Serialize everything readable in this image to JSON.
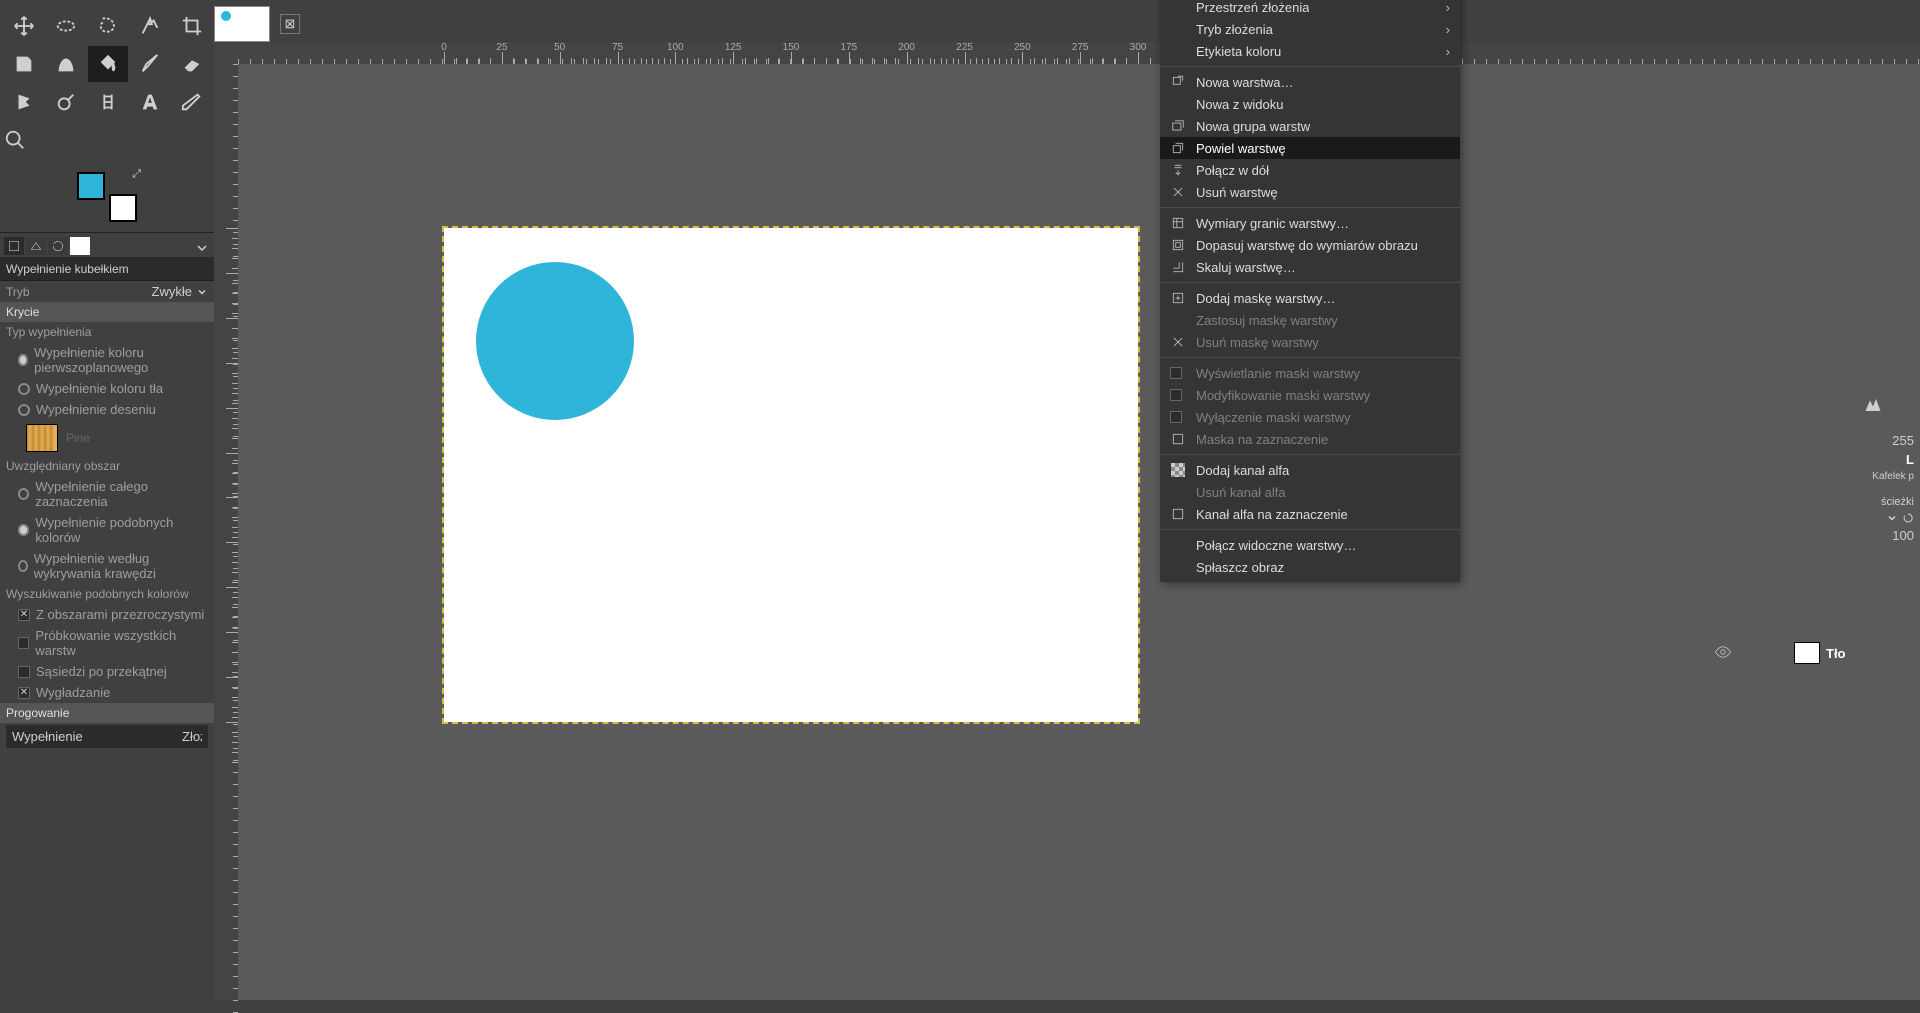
{
  "tools": {
    "names": [
      "move-tool",
      "rect-select-tool",
      "free-select-tool",
      "fuzzy-select-tool",
      "crop-tool",
      "rotate-tool",
      "flip-tool",
      "bucket-fill-tool",
      "paintbrush-tool",
      "eraser-tool",
      "smudge-tool",
      "color-picker-tool",
      "measure-tool",
      "text-tool",
      "heal-tool",
      "zoom-tool"
    ],
    "active_index": 7,
    "fg_color": "#2eb5d9",
    "bg_color": "#ffffff"
  },
  "tool_options": {
    "title": "Wypełnienie kubełkiem",
    "mode_label": "Tryb",
    "mode_value": "Zwykłe",
    "opacity_label": "Krycie",
    "fill_type_title": "Typ wypełnienia",
    "fill_fg": "Wypełnienie koloru pierwszoplanowego",
    "fill_bg": "Wypełnienie koloru tła",
    "fill_pattern": "Wypełnienie deseniu",
    "pattern_name": "Pine",
    "area_title": "Uwzględniany obszar",
    "area_whole": "Wypełnienie całego zaznaczenia",
    "area_similar": "Wypełnienie podobnych kolorów",
    "area_edge": "Wypełnienie według wykrywania krawędzi",
    "finding_title": "Wyszukiwanie podobnych kolorów",
    "opt_transparent": "Z obszarami przezroczystymi",
    "opt_sample_all": "Próbkowanie wszystkich warstw",
    "opt_diagonal": "Sąsiedzi po przekątnej",
    "opt_antialias": "Wygładzanie",
    "threshold_label": "Progowanie",
    "fill_by_label": "Wypełnienie",
    "fill_by_value": "Złożone"
  },
  "ruler_marks": [
    0,
    25,
    50,
    75,
    100,
    125,
    150,
    175,
    200,
    225,
    250,
    275,
    300
  ],
  "canvas": {
    "circle_color": "#2eb5d9"
  },
  "layers_peek": {
    "opacity": "255",
    "mode_short": "L",
    "lock_short": "Kafelek p",
    "paths": "ścieżki",
    "per": "100",
    "layer_name": "Tło"
  },
  "context_menu": {
    "items": [
      {
        "label": "Przestrzeń złożenia",
        "submenu": true,
        "truncated": true
      },
      {
        "label": "Tryb złożenia",
        "submenu": true
      },
      {
        "label": "Etykieta koloru",
        "submenu": true
      },
      {
        "sep": true
      },
      {
        "label": "Nowa warstwa…",
        "icon": "new-layer-icon"
      },
      {
        "label": "Nowa z widoku"
      },
      {
        "label": "Nowa grupa warstw",
        "icon": "layer-group-icon"
      },
      {
        "label": "Powiel warstwę",
        "icon": "duplicate-icon",
        "hl": true
      },
      {
        "label": "Połącz w dół",
        "icon": "merge-down-icon"
      },
      {
        "label": "Usuń warstwę",
        "icon": "delete-icon"
      },
      {
        "sep": true
      },
      {
        "label": "Wymiary granic warstwy…",
        "icon": "boundary-icon"
      },
      {
        "label": "Dopasuj warstwę do wymiarów obrazu",
        "icon": "fit-icon"
      },
      {
        "label": "Skaluj warstwę…",
        "icon": "scale-icon"
      },
      {
        "sep": true
      },
      {
        "label": "Dodaj maskę warstwy…",
        "icon": "add-mask-icon"
      },
      {
        "label": "Zastosuj maskę warstwy",
        "disabled": true
      },
      {
        "label": "Usuń maskę warstwy",
        "icon": "delete-icon",
        "disabled": true
      },
      {
        "sep": true
      },
      {
        "label": "Wyświetlanie maski warstwy",
        "checkbox": true,
        "disabled": true
      },
      {
        "label": "Modyfikowanie maski warstwy",
        "checkbox": true,
        "disabled": true
      },
      {
        "label": "Wyłączenie maski warstwy",
        "checkbox": true,
        "disabled": true
      },
      {
        "label": "Maska na zaznaczenie",
        "icon": "mask-to-sel-icon",
        "disabled": true
      },
      {
        "sep": true
      },
      {
        "label": "Dodaj kanał alfa",
        "icon": "alpha-icon"
      },
      {
        "label": "Usuń kanał alfa",
        "disabled": true
      },
      {
        "label": "Kanał alfa na zaznaczenie",
        "icon": "alpha-to-sel-icon"
      },
      {
        "sep": true
      },
      {
        "label": "Połącz widoczne warstwy…"
      },
      {
        "label": "Spłaszcz obraz"
      }
    ]
  }
}
